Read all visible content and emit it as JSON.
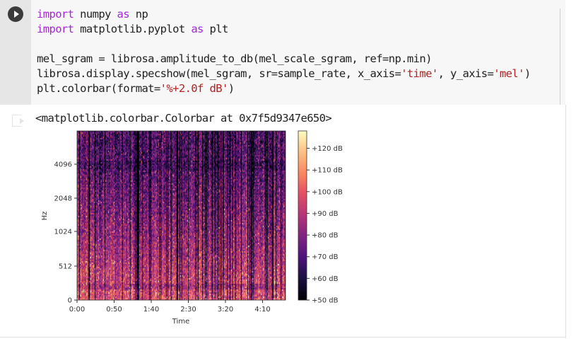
{
  "cell": {
    "run_button": "play-icon",
    "code_lines": [
      [
        {
          "t": "import",
          "c": "kw"
        },
        {
          "t": " numpy "
        },
        {
          "t": "as",
          "c": "kw"
        },
        {
          "t": " np"
        }
      ],
      [
        {
          "t": "import",
          "c": "kw"
        },
        {
          "t": " matplotlib.pyplot "
        },
        {
          "t": "as",
          "c": "kw"
        },
        {
          "t": " plt"
        }
      ],
      [],
      [
        {
          "t": "mel_sgram = librosa.amplitude_to_db(mel_scale_sgram, ref=np.min)"
        }
      ],
      [
        {
          "t": "librosa.display.specshow(mel_sgram, sr=sample_rate, x_axis="
        },
        {
          "t": "'time'",
          "c": "str"
        },
        {
          "t": ", y_axis="
        },
        {
          "t": "'mel'",
          "c": "str"
        },
        {
          "t": ")"
        }
      ],
      [
        {
          "t": "plt.colorbar(format="
        },
        {
          "t": "'%+2.0f dB'",
          "c": "str"
        },
        {
          "t": ")"
        }
      ]
    ]
  },
  "output": {
    "text": "<matplotlib.colorbar.Colorbar at 0x7f5d9347e650>"
  },
  "chart_data": {
    "type": "heatmap",
    "colormap": "magma",
    "xlabel": "Time",
    "ylabel": "Hz",
    "x_ticks": [
      "0:00",
      "0:50",
      "1:40",
      "2:30",
      "3:20",
      "4:10"
    ],
    "y_ticks": [
      "0",
      "512",
      "1024",
      "2048",
      "4096"
    ],
    "y_scale": "mel",
    "colorbar": {
      "ticks": [
        "+50 dB",
        "+60 dB",
        "+70 dB",
        "+80 dB",
        "+90 dB",
        "+100 dB",
        "+110 dB",
        "+120 dB"
      ],
      "range": [
        50,
        128
      ]
    }
  }
}
